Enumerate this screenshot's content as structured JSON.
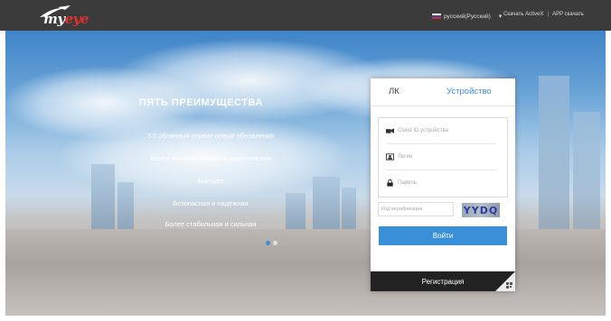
{
  "header": {
    "logo_text_1": "my",
    "logo_text_2": "eye",
    "language": "русский(Русский)",
    "link_activex": "Скачать ActiveX",
    "separator": "|",
    "link_app": "APP скачать"
  },
  "advantages": {
    "title": "ПЯТЬ ПРЕИМУЩЕСТВА",
    "items": [
      "3.0 облачный сервис новый обновления",
      "Более высокая скорость подключения",
      "быстрее",
      "Безопасная и надежная",
      "Более стабильная и сильная"
    ]
  },
  "login": {
    "tab_lk": "ЛК",
    "tab_device": "Устройство",
    "cloud_id_placeholder": "Cloud ID устройства",
    "login_placeholder": "Логин",
    "password_placeholder": "Пароль",
    "captcha_placeholder": "Код верификации",
    "captcha_text": "YYDQ",
    "submit": "Войти",
    "register": "Регистрация"
  },
  "colors": {
    "accent": "#3a8fd9",
    "topbar": "#3b3b3b",
    "register_bg": "#222222"
  }
}
